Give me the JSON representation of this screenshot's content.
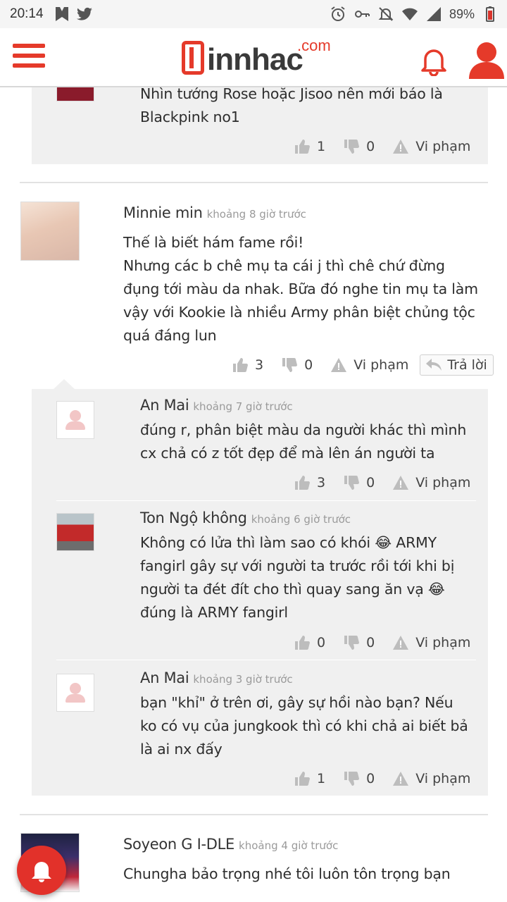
{
  "status_bar": {
    "time": "20:14",
    "battery": "89%"
  },
  "header": {
    "logo_text": "innhac",
    "logo_com": ".com"
  },
  "comments": [
    {
      "text_lines": [
        "Nhìn tướng Rose hoặc Jisoo nên mới báo là",
        "Blackpink no1"
      ],
      "likes": "1",
      "dislikes": "0",
      "report": "Vi phạm"
    },
    {
      "name": "Minnie min",
      "time": "khoảng 8 giờ trước",
      "text_lines": [
        "Thế là biết hám fame rồi!",
        "Nhưng các b chê mụ ta cái j thì chê chứ đừng",
        "đụng tới màu da nhak. Bữa đó nghe tin mụ ta làm",
        "vậy với Kookie là nhiều Army phân biệt chủng tộc",
        "quá đáng lun"
      ],
      "likes": "3",
      "dislikes": "0",
      "report": "Vi phạm",
      "reply": "Trả lời"
    },
    {
      "name": "An Mai",
      "time": "khoảng 7 giờ trước",
      "text_lines": [
        "đúng r, phân biệt màu da người khác thì mình",
        "cx chả có z tốt đẹp để mà lên án người ta"
      ],
      "likes": "3",
      "dislikes": "0",
      "report": "Vi phạm"
    },
    {
      "name": "Ton Ngộ không",
      "time": "khoảng 6 giờ trước",
      "text_lines": [
        "Không có lửa thì làm sao có khói 😂 ARMY",
        "fangirl gây sự với người ta trước rồi tới khi bị",
        "người ta đét đít cho thì quay sang ăn vạ 😂",
        "đúng là ARMY fangirl"
      ],
      "likes": "0",
      "dislikes": "0",
      "report": "Vi phạm"
    },
    {
      "name": "An Mai",
      "time": "khoảng 3 giờ trước",
      "text_lines": [
        "bạn \"khỉ\" ở trên ơi, gây sự hồi nào bạn? Nếu",
        "ko có vụ của jungkook thì có khi chả ai biết bả",
        "là ai nx đấy"
      ],
      "likes": "1",
      "dislikes": "0",
      "report": "Vi phạm"
    },
    {
      "name": "Soyeon G I-DLE",
      "time": "khoảng 4 giờ trước",
      "text_lines": [
        "Chungha bảo trọng nhé tôi luôn tôn trọng bạn"
      ]
    }
  ],
  "colors": {
    "brand_red": "#e53a2a",
    "reply_bg": "#f0f0f0",
    "meta_grey": "#9a9a9a"
  }
}
